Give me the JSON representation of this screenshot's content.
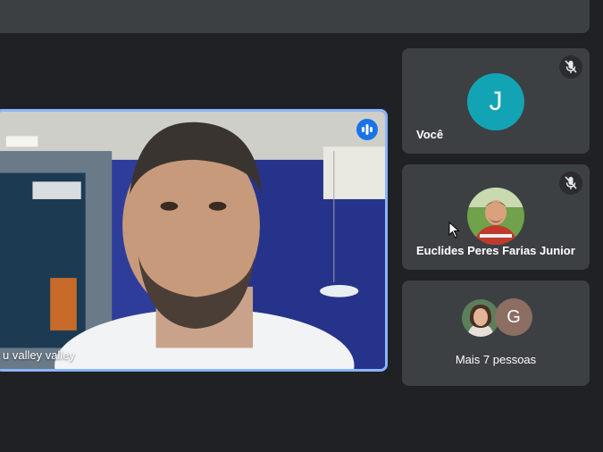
{
  "main_tile": {
    "participant_name": "u valley valley",
    "speaking_icon": "audio-level-icon"
  },
  "participants": [
    {
      "name": "Você",
      "avatar_letter": "J",
      "avatar_color": "#12a4b4",
      "muted": true,
      "mute_icon": "mic-off-icon"
    },
    {
      "name": "Euclides Peres Farias Junior",
      "muted": true,
      "mute_icon": "mic-off-icon"
    }
  ],
  "more_tile": {
    "label": "Mais 7 pessoas",
    "avatar_letter": "G",
    "avatar_color": "#8d6e63"
  },
  "colors": {
    "background": "#202124",
    "tile": "#3c4043",
    "active_speaker_border": "#8ab4f8",
    "speaking_badge": "#1a73e8"
  }
}
